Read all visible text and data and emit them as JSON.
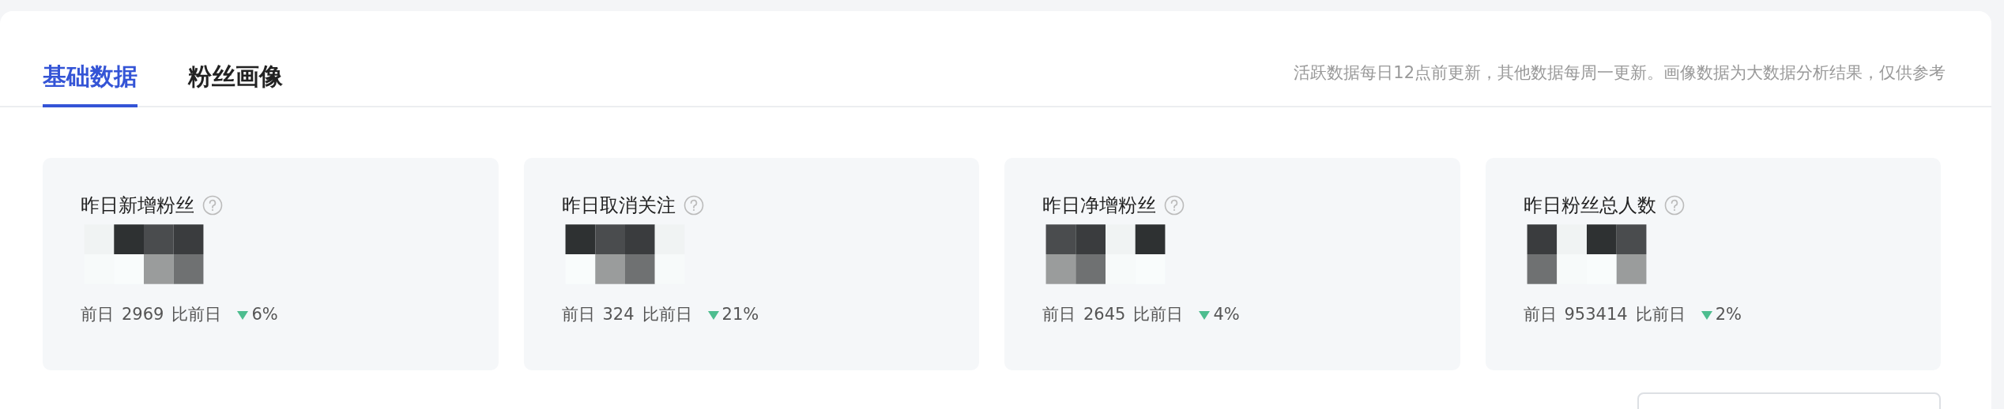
{
  "tabs": [
    {
      "label": "基础数据",
      "selected": true
    },
    {
      "label": "粉丝画像",
      "selected": false
    }
  ],
  "note": "活跃数据每日12点前更新，其他数据每周一更新。画像数据为大数据分析结果，仅供参考",
  "cards": [
    {
      "title": "昨日新增粉丝",
      "previous_label": "前日",
      "previous_value": "2969",
      "compare_label": "比前日",
      "decreased": true,
      "change": "6%"
    },
    {
      "title": "昨日取消关注",
      "previous_label": "前日",
      "previous_value": "324",
      "compare_label": "比前日",
      "decreased": true,
      "change": "21%"
    },
    {
      "title": "昨日净增粉丝",
      "previous_label": "前日",
      "previous_value": "2645",
      "compare_label": "比前日",
      "decreased": true,
      "change": "4%"
    },
    {
      "title": "昨日粉丝总人数",
      "previous_label": "前日",
      "previous_value": "953414",
      "compare_label": "比前日",
      "decreased": true,
      "change": "2%"
    }
  ]
}
